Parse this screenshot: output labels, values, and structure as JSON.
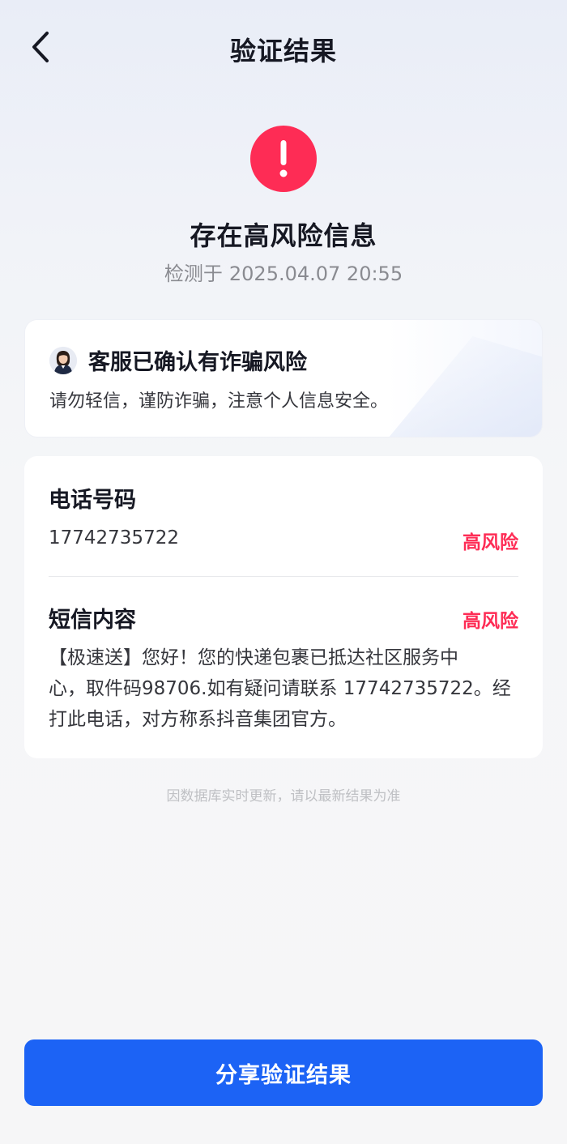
{
  "nav": {
    "title": "验证结果"
  },
  "result": {
    "headline": "存在高风险信息",
    "detect_prefix": "检测于",
    "detect_time": "2025.04.07 20:55"
  },
  "confirm": {
    "title": "客服已确认有诈骗风险",
    "desc": "请勿轻信，谨防诈骗，注意个人信息安全。"
  },
  "detail": {
    "phone_title": "电话号码",
    "phone_number": "17742735722",
    "phone_risk": "高风险",
    "sms_title": "短信内容",
    "sms_risk": "高风险",
    "sms_lines": [
      "【极速送】您好！您的快递包裹已抵达社区服务中",
      "心，取件码98706.如有疑问请联系 17742735722。经",
      "打此电话，对方称系抖音集团官方。"
    ]
  },
  "footnote": "因数据库实时更新，请以最新结果为准",
  "share_button": "分享验证结果",
  "colors": {
    "danger": "#fe2c55",
    "primary": "#1c63f5"
  },
  "icons": {
    "back": "chevron-left-icon",
    "alert": "exclamation-icon",
    "avatar": "customer-service-avatar"
  }
}
